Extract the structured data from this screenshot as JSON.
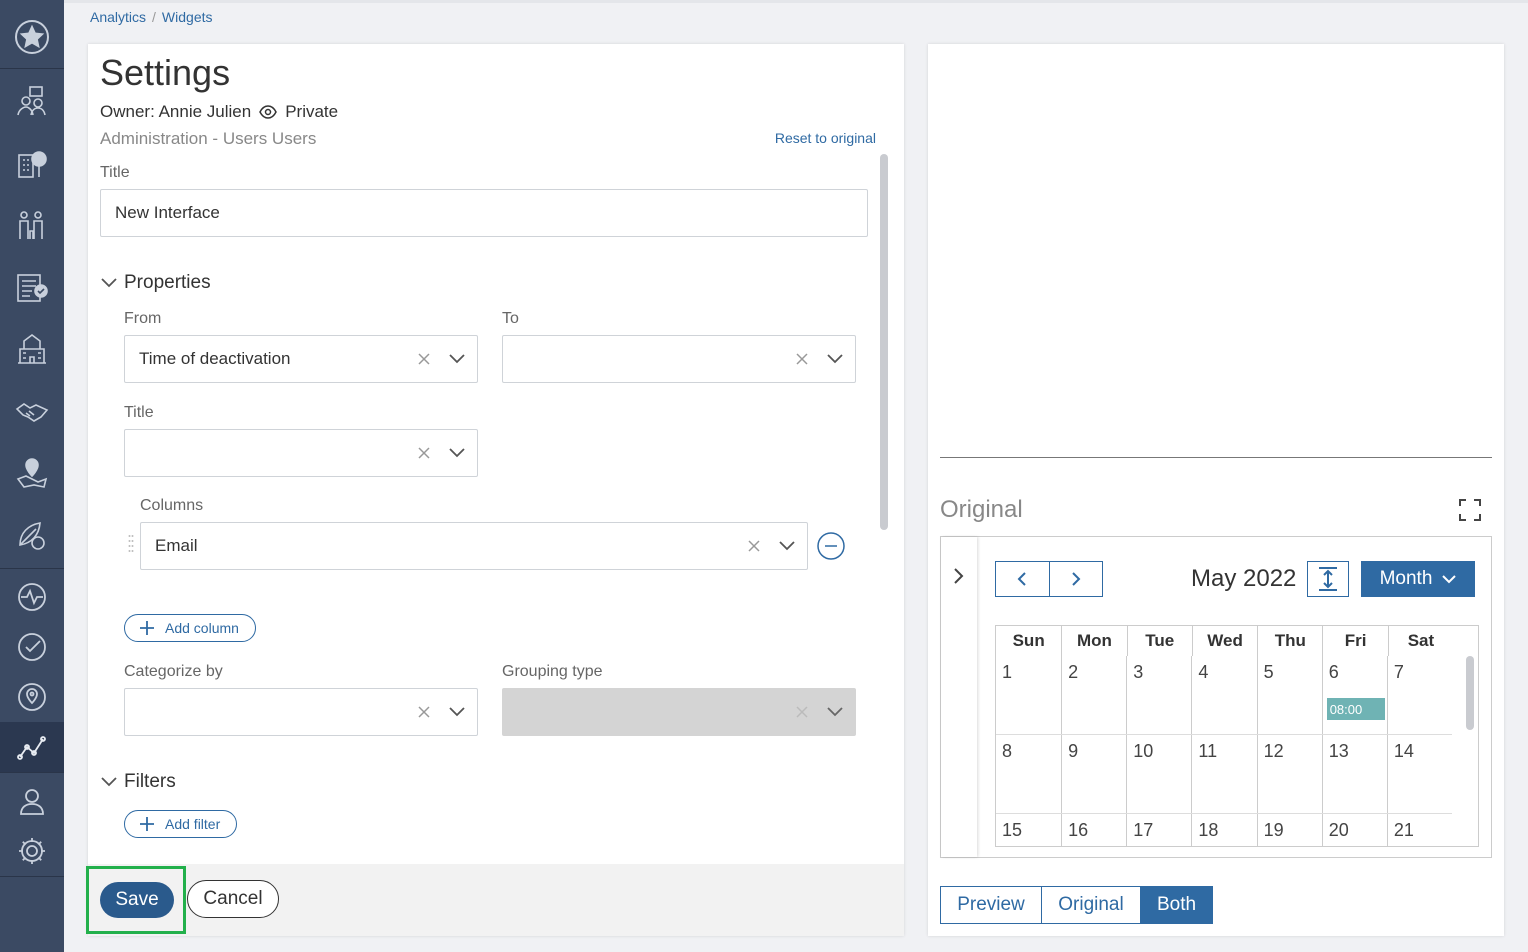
{
  "breadcrumb": {
    "item1": "Analytics",
    "separator": "/",
    "item2": "Widgets"
  },
  "sidebar": {
    "items": [
      {
        "name": "favorites-icon"
      },
      {
        "name": "people-chat-icon"
      },
      {
        "name": "building-tree-icon"
      },
      {
        "name": "family-icon"
      },
      {
        "name": "checklist-icon"
      },
      {
        "name": "school-building-icon"
      },
      {
        "name": "handshake-icon"
      },
      {
        "name": "map-pin-icon"
      },
      {
        "name": "leaves-icon"
      },
      {
        "name": "activity-icon"
      },
      {
        "name": "check-circle-icon"
      },
      {
        "name": "location-icon"
      },
      {
        "name": "analytics-icon",
        "active": true
      },
      {
        "name": "user-icon"
      },
      {
        "name": "gear-icon"
      }
    ]
  },
  "settings": {
    "title": "Settings",
    "owner": "Owner: Annie Julien",
    "privacy": "Private",
    "subtitle": "Administration - Users Users",
    "reset_label": "Reset to original",
    "title_label": "Title",
    "title_value": "New Interface",
    "properties_label": "Properties",
    "from_label": "From",
    "from_value": "Time of deactivation",
    "to_label": "To",
    "prop_title_label": "Title",
    "columns_label": "Columns",
    "column_value": "Email",
    "add_column_label": "Add column",
    "categorize_label": "Categorize by",
    "grouping_label": "Grouping type",
    "filters_label": "Filters",
    "add_filter_label": "Add filter",
    "save_label": "Save",
    "cancel_label": "Cancel"
  },
  "preview": {
    "original_label": "Original",
    "calendar": {
      "month": "May 2022",
      "view": "Month",
      "weekdays": [
        "Sun",
        "Mon",
        "Tue",
        "Wed",
        "Thu",
        "Fri",
        "Sat"
      ],
      "weeks": [
        [
          "1",
          "2",
          "3",
          "4",
          "5",
          "6",
          "7"
        ],
        [
          "8",
          "9",
          "10",
          "11",
          "12",
          "13",
          "14"
        ],
        [
          "15",
          "16",
          "17",
          "18",
          "19",
          "20",
          "21"
        ]
      ],
      "event_time": "08:00"
    },
    "modes": [
      "Preview",
      "Original",
      "Both"
    ],
    "active_mode": "Both"
  },
  "colors": {
    "sidebar": "#3b4a63",
    "accent": "#2f6aa3",
    "save": "#2a5a8c",
    "highlight": "#22b04b",
    "event": "#6fb3b4"
  }
}
